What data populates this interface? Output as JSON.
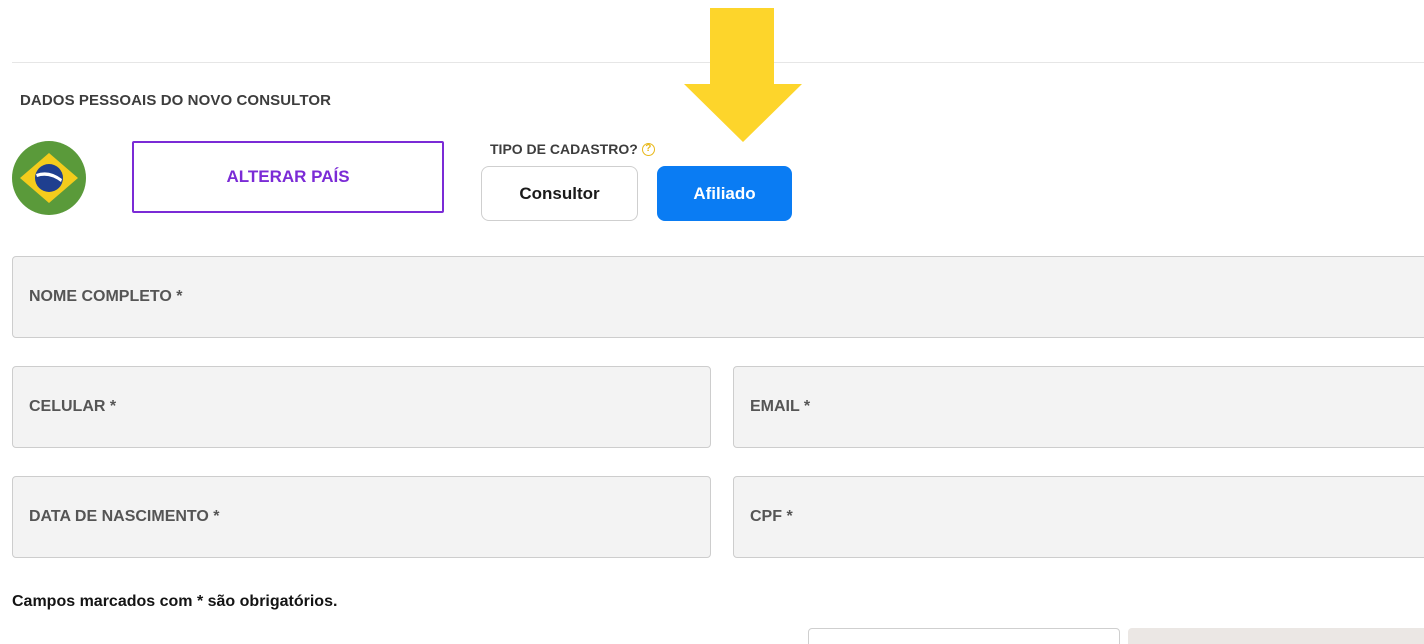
{
  "section": {
    "title": "DADOS PESSOAIS DO NOVO CONSULTOR"
  },
  "country": {
    "flag_icon": "brazil-flag-icon",
    "change_label": "ALTERAR PAÍS",
    "accent_color": "#7b2bd6"
  },
  "registration_type": {
    "label": "TIPO DE CADASTRO?",
    "help_icon": "question-circle-icon",
    "help_glyph": "?",
    "options": [
      {
        "label": "Consultor",
        "selected": false
      },
      {
        "label": "Afiliado",
        "selected": true
      }
    ],
    "selected_color": "#0a7cf3"
  },
  "annotation": {
    "arrow_icon": "arrow-down-icon",
    "color": "#fdd52b"
  },
  "form": {
    "full_name": {
      "placeholder": "NOME COMPLETO *",
      "value": ""
    },
    "phone": {
      "placeholder": "CELULAR *",
      "value": ""
    },
    "email": {
      "placeholder": "EMAIL *",
      "value": ""
    },
    "birth_date": {
      "placeholder": "DATA DE NASCIMENTO *",
      "value": ""
    },
    "cpf": {
      "placeholder": "CPF *",
      "value": ""
    }
  },
  "required_note": "Campos marcados com * são obrigatórios."
}
